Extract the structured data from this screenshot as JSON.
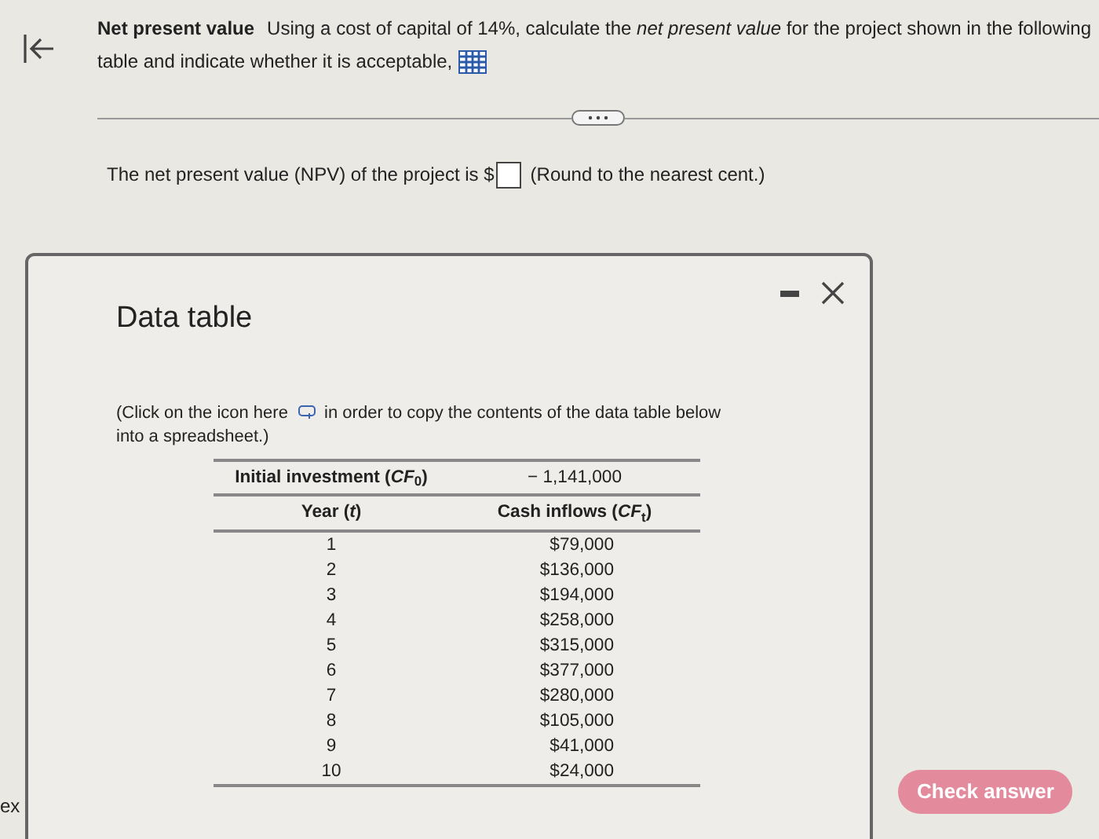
{
  "question": {
    "title": "Net present value",
    "text": "Using a cost of capital of 14%, calculate the *net present value* for the project shown in the following table and indicate whether it is acceptable,"
  },
  "answer": {
    "prompt": "The net present value (NPV) of the project is $",
    "hint": "(Round to the nearest cent.)"
  },
  "side_text": "ex",
  "check_button": "Check answer",
  "dialog": {
    "title": "Data table",
    "note_before": "(Click on the icon here",
    "note_after": "in order to copy the contents of the data table below into a spreadsheet.)",
    "initial_label": "Initial investment (*CF*$_{0}$)",
    "initial_value": "− 1,141,000",
    "columns": [
      "Year (*t*)",
      "Cash inflows (*CF*$_{t}$)"
    ],
    "rows": [
      [
        "1",
        "$79,000"
      ],
      [
        "2",
        "$136,000"
      ],
      [
        "3",
        "$194,000"
      ],
      [
        "4",
        "$258,000"
      ],
      [
        "5",
        "$315,000"
      ],
      [
        "6",
        "$377,000"
      ],
      [
        "7",
        "$280,000"
      ],
      [
        "8",
        "$105,000"
      ],
      [
        "9",
        "$41,000"
      ],
      [
        "10",
        "$24,000"
      ]
    ]
  }
}
